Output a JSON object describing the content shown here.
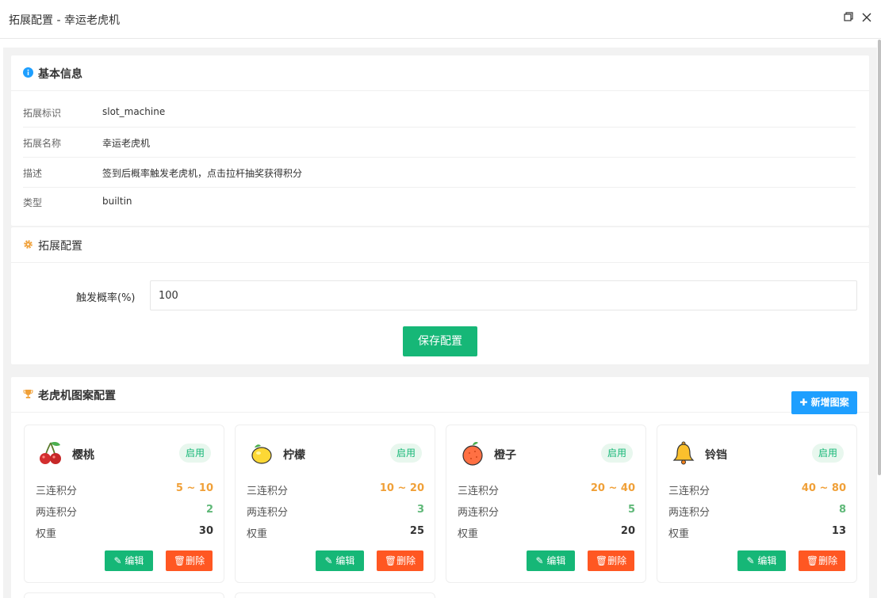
{
  "window": {
    "title": "拓展配置 - 幸运老虎机",
    "restore_icon": "restore-icon",
    "close_icon": "close-icon"
  },
  "basic": {
    "title": "基本信息",
    "icon": "info-icon",
    "rows": [
      {
        "label": "拓展标识",
        "value": "slot_machine"
      },
      {
        "label": "拓展名称",
        "value": "幸运老虎机"
      },
      {
        "label": "描述",
        "value": "签到后概率触发老虎机，点击拉杆抽奖获得积分"
      },
      {
        "label": "类型",
        "value": "builtin"
      }
    ]
  },
  "config": {
    "title": "拓展配置",
    "icon": "gear-icon",
    "field_label": "触发概率(%)",
    "field_value": "100",
    "save_label": "保存配置"
  },
  "symbols": {
    "title": "老虎机图案配置",
    "icon": "trophy-icon",
    "add_label": "新增图案",
    "stat_labels": {
      "triple": "三连积分",
      "double": "两连积分",
      "weight": "权重"
    },
    "edit_label": "编辑",
    "delete_label": "删除",
    "items": [
      {
        "name": "樱桃",
        "icon": "cherry-icon",
        "status": "启用",
        "triple": "5 ~ 10",
        "double": "2",
        "weight": "30"
      },
      {
        "name": "柠檬",
        "icon": "lemon-icon",
        "status": "启用",
        "triple": "10 ~ 20",
        "double": "3",
        "weight": "25"
      },
      {
        "name": "橙子",
        "icon": "orange-icon",
        "status": "启用",
        "triple": "20 ~ 40",
        "double": "5",
        "weight": "20"
      },
      {
        "name": "铃铛",
        "icon": "bell-icon",
        "status": "启用",
        "triple": "40 ~ 80",
        "double": "8",
        "weight": "13"
      }
    ]
  },
  "colors": {
    "primary": "#16b777",
    "danger": "#ff5722",
    "info": "#1e9fff",
    "accent": "#f0a038"
  }
}
